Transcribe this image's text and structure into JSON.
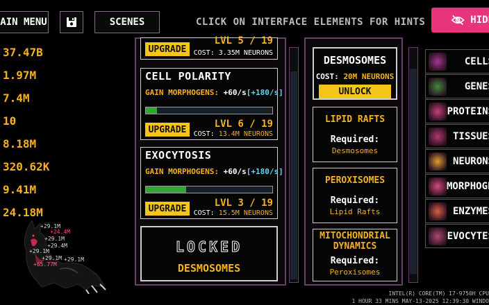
{
  "topbar": {
    "main_menu": "AIN MENU",
    "save_icon": "floppy-disk-icon",
    "scenes": "SCENES",
    "hint": "CLICK ON INTERFACE ELEMENTS FOR HINTS",
    "hide": "HIDE"
  },
  "stats": [
    "37.47B",
    "1.97M",
    "7.4M",
    "10",
    "8.18M",
    "320.62K",
    "9.41M",
    "24.18M"
  ],
  "creature_labels": [
    "+29.1M",
    "+24.4M",
    "+29.1M",
    "+29.4M",
    "+29.1M",
    "+29.1M",
    "+65.77M",
    "+29.1M"
  ],
  "upgrades": {
    "top_partial": {
      "upgrade": "UPGRADE",
      "level": "LVL 5 / 19",
      "cost": "COST: 3.35M NEURONS"
    },
    "items": [
      {
        "title": "CELL POLARITY",
        "gain_label": "GAIN MORPHOGENS:",
        "gain": "+60/s",
        "bonus": "[+180/s]",
        "progress": 0.09,
        "upgrade": "UPGRADE",
        "level": "LVL 6 / 19",
        "cost_label": "COST:",
        "cost": "13.4M NEURONS"
      },
      {
        "title": "EXOCYTOSIS",
        "gain_label": "GAIN MORPHOGENS:",
        "gain": "+60/s",
        "bonus": "[+180/s]",
        "progress": 0.32,
        "upgrade": "UPGRADE",
        "level": "LVL 3 / 19",
        "cost_label": "COST:",
        "cost": "15.5M NEURONS"
      }
    ],
    "locked": {
      "title": "LOCKED",
      "name": "DESMOSOMES"
    }
  },
  "research": {
    "current": {
      "title": "DESMOSOMES",
      "cost_label": "COST:",
      "cost": "20M NEURONS",
      "unlock": "UNLOCK"
    },
    "items": [
      {
        "title": "LIPID RAFTS",
        "required_label": "Required:",
        "required": "Desmosomes"
      },
      {
        "title": "PEROXISOMES",
        "required_label": "Required:",
        "required": "Lipid Rafts"
      },
      {
        "title": "MITOCHONDRIAL DYNAMICS",
        "required_label": "Required:",
        "required": "Peroxisomes"
      }
    ]
  },
  "sidebar": [
    {
      "label": "CELLS",
      "icon": "cell-icon",
      "color": "#a3358f"
    },
    {
      "label": "GENES",
      "icon": "dna-icon",
      "color": "#3f8f3a"
    },
    {
      "label": "PROTEINS",
      "icon": "protein-icon",
      "color": "#c0407a"
    },
    {
      "label": "TISSUES",
      "icon": "tissue-icon",
      "color": "#b03a6a"
    },
    {
      "label": "NEURONS",
      "icon": "neuron-icon",
      "color": "#e0a030"
    },
    {
      "label": "MORPHOGENS",
      "icon": "morphogen-icon",
      "color": "#d84a7a"
    },
    {
      "label": "ENZYMES",
      "icon": "enzyme-icon",
      "color": "#d86040"
    },
    {
      "label": "EVOCYTES",
      "icon": "evocyte-icon",
      "color": "#b04a70"
    }
  ],
  "system": {
    "cpu": "INTEL(R) CORE(TM) I7-9750H CPU",
    "time": "1 HOUR 33 MINS  MAY-13-2025 12:39:30  WINDO"
  },
  "colors": {
    "accent": "#f5b21e",
    "hide": "#e8347c",
    "panel_border": "#6a3f6a",
    "progress": "#2ea82e"
  }
}
